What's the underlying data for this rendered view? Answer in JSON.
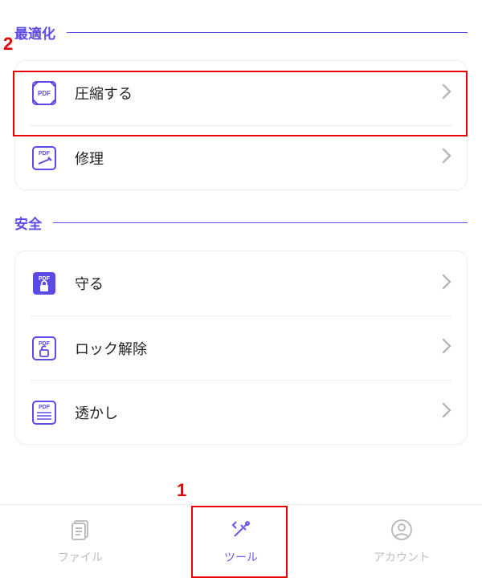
{
  "annotations": {
    "one": "1",
    "two": "2"
  },
  "sections": {
    "optimize": {
      "title": "最適化",
      "items": {
        "compress": "圧縮する",
        "repair": "修理"
      }
    },
    "security": {
      "title": "安全",
      "items": {
        "protect": "守る",
        "unlock": "ロック解除",
        "watermark": "透かし"
      }
    }
  },
  "tabs": {
    "files": "ファイル",
    "tools": "ツール",
    "account": "アカウント"
  },
  "colors": {
    "accent": "#5B4AE6",
    "highlight": "#E80000"
  }
}
